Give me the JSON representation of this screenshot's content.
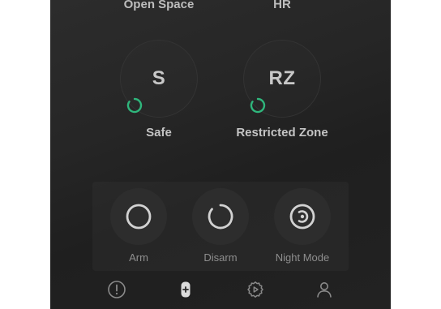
{
  "zones": [
    {
      "title": "Open Space",
      "code": "S",
      "label": "Safe",
      "status": "armed-indicator"
    },
    {
      "title": "HR",
      "code": "RZ",
      "label": "Restricted Zone",
      "status": "armed-indicator"
    }
  ],
  "actions": [
    {
      "label": "Arm",
      "icon": "ring-icon"
    },
    {
      "label": "Disarm",
      "icon": "open-ring-icon"
    },
    {
      "label": "Night Mode",
      "icon": "target-icon"
    }
  ],
  "nav": [
    {
      "icon": "alert-circle-icon"
    },
    {
      "icon": "remote-control-icon",
      "active": true
    },
    {
      "icon": "settings-gear-icon"
    },
    {
      "icon": "user-icon"
    }
  ],
  "colors": {
    "status_green": "#2fb67c",
    "icon_light": "#d2d2d2",
    "icon_muted": "#8a8a8a"
  }
}
